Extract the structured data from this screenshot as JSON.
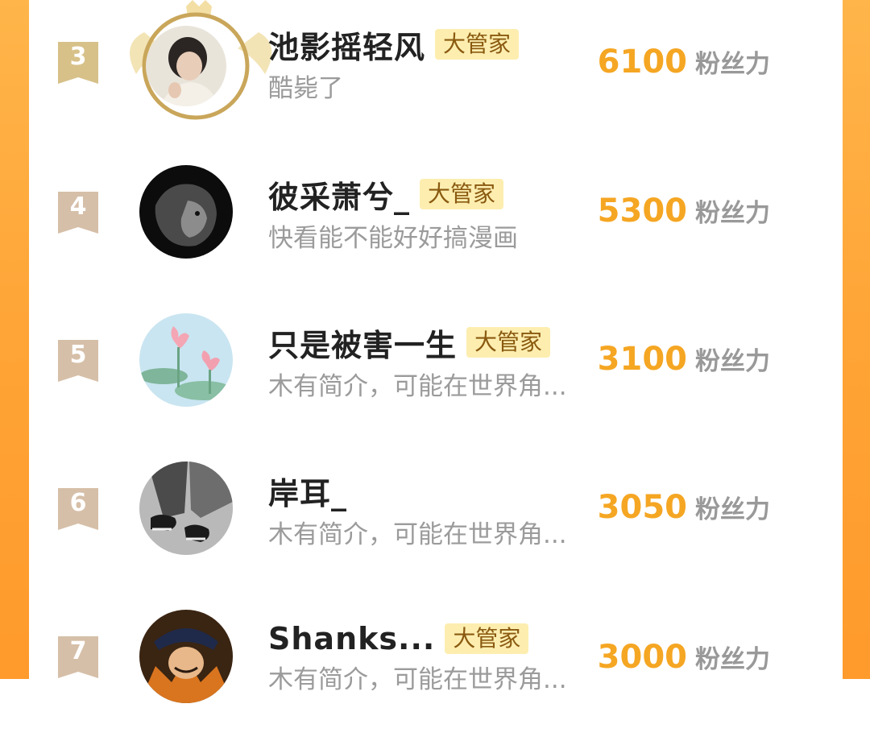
{
  "colors": {
    "accent": "#f5a623",
    "border": "#ffa436",
    "badge_bg": "#fdeeb0",
    "bio": "#9b9b9b"
  },
  "rows": [
    {
      "rank": "3",
      "name": "池影摇轻风",
      "badge": "大管家",
      "bio": "酷毙了",
      "score": "6100",
      "unit": "粉丝力",
      "avatar": "photo-young-man-avatar"
    },
    {
      "rank": "4",
      "name": "彼采萧兮_",
      "badge": "大管家",
      "bio": "快看能不能好好搞漫画",
      "score": "5300",
      "unit": "粉丝力",
      "avatar": "lion-avatar"
    },
    {
      "rank": "5",
      "name": "只是被害一生",
      "badge": "大管家",
      "bio": "木有简介，可能在世界角...",
      "score": "3100",
      "unit": "粉丝力",
      "avatar": "lotus-avatar"
    },
    {
      "rank": "6",
      "name": "岸耳_",
      "badge": "",
      "bio": "木有简介，可能在世界角...",
      "score": "3050",
      "unit": "粉丝力",
      "avatar": "sneakers-avatar"
    },
    {
      "rank": "7",
      "name": "Shanks...",
      "badge": "大管家",
      "bio": "木有简介，可能在世界角...",
      "score": "3000",
      "unit": "粉丝力",
      "avatar": "anime-avatar"
    }
  ]
}
